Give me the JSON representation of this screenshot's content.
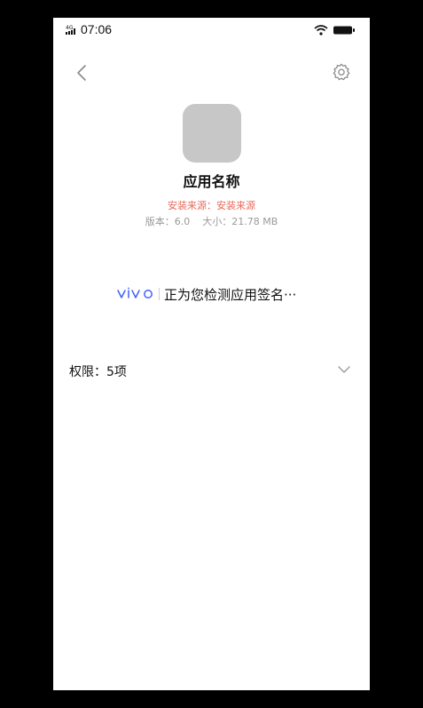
{
  "status_bar": {
    "signal_label": "4G",
    "time": "07:06",
    "wifi_icon": "wifi-icon",
    "battery_icon": "battery-icon"
  },
  "header": {
    "back_icon": "chevron-left-icon",
    "settings_icon": "gear-icon"
  },
  "app": {
    "name": "应用名称",
    "source": "安装来源：安装来源",
    "version": "版本：6.0",
    "size": "大小：21.78 MB",
    "icon_color": "#c7c7c7"
  },
  "scan": {
    "brand": "vivo",
    "message": "正为您检测应用签名···",
    "brand_color": "#415fff"
  },
  "permissions": {
    "label": "权限：5项",
    "expand_icon": "chevron-down-icon"
  },
  "colors": {
    "source_text": "#e86a5a",
    "meta_text": "#9a9a9a"
  }
}
